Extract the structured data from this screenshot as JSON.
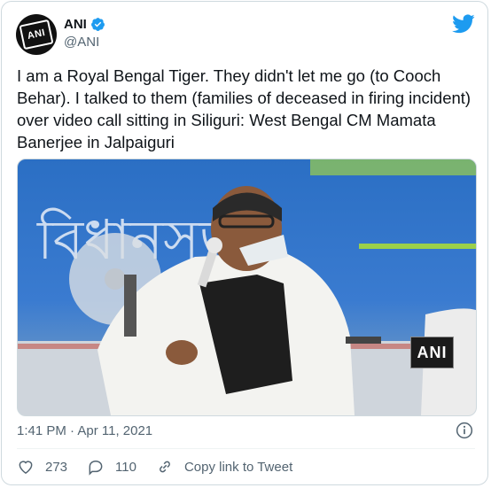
{
  "author": {
    "name": "ANI",
    "handle": "@ANI",
    "avatar_text": "ANI",
    "verified_icon": "verified-badge-icon"
  },
  "tweet": {
    "text": "I am a Royal Bengal Tiger. They didn't let me go (to Cooch Behar). I talked to them (families of deceased in firing incident) over video call sitting in Siliguri: West Bengal CM Mamata Banerjee in Jalpaiguri"
  },
  "media": {
    "watermark": "ANI",
    "banner_text": "বিধানসভা"
  },
  "meta": {
    "timestamp": "1:41 PM · Apr 11, 2021"
  },
  "actions": {
    "likes": "273",
    "replies": "110",
    "copy_link": "Copy link to Tweet"
  },
  "colors": {
    "brand_blue": "#1d9bf0",
    "muted": "#536471",
    "border": "#cfd9de"
  }
}
